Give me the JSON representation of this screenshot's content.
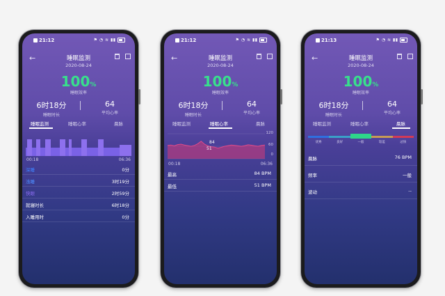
{
  "common": {
    "title": "睡眠监测",
    "date": "2020-08-24",
    "efficiency": "100",
    "efficiency_unit": "%",
    "efficiency_label": "睡眠效率",
    "duration": "6时18分",
    "duration_label": "睡眠时长",
    "avg_hr": "64",
    "avg_hr_label": "平均心率",
    "tabs": [
      "睡眠监测",
      "睡眠心率",
      "晨脉"
    ]
  },
  "phones": [
    {
      "time": "21:12",
      "active_tab": 0,
      "chart": {
        "start": "00:18",
        "end": "06:36"
      },
      "rows": [
        {
          "key": "深睡",
          "value": "0分",
          "color": "#3f82ff"
        },
        {
          "key": "浅睡",
          "value": "3时19分",
          "color": "#4e8dff"
        },
        {
          "key": "快眼",
          "value": "2时59分",
          "color": "#8a6df0"
        },
        {
          "key": "就寝时长",
          "value": "6时18分",
          "color": "#ffffff"
        },
        {
          "key": "入睡用时",
          "value": "0分",
          "color": "#ffffff"
        }
      ]
    },
    {
      "time": "21:12",
      "active_tab": 1,
      "chart": {
        "start": "00:18",
        "end": "06:36",
        "y_ticks": [
          "120",
          "60",
          "0"
        ],
        "max_marker": "84",
        "min_marker": "51"
      },
      "rows": [
        {
          "key": "最高",
          "value": "84 BPM"
        },
        {
          "key": "最低",
          "value": "51 BPM"
        }
      ]
    },
    {
      "time": "21:13",
      "active_tab": 2,
      "scale": {
        "labels": [
          "优秀",
          "良好",
          "一般",
          "较差",
          "过快"
        ],
        "colors": [
          "#2f6fe0",
          "#3aa0c8",
          "#2ed68a",
          "#c79a55",
          "#d23a57"
        ],
        "current_index": 2
      },
      "rows": [
        {
          "key": "晨脉",
          "value": "76 BPM"
        },
        {
          "key": "频率",
          "value": "一般"
        },
        {
          "key": "波动",
          "value": "--"
        }
      ]
    }
  ],
  "chart_data": [
    {
      "type": "bar",
      "title": "",
      "x_range": [
        "00:18",
        "06:36"
      ],
      "note": "sleep stage timeline, alternating light sleep and REM",
      "series": [
        {
          "name": "浅睡",
          "total": "3时19分"
        },
        {
          "name": "快眼",
          "total": "2时59分"
        }
      ]
    },
    {
      "type": "line",
      "title": "",
      "x_range": [
        "00:18",
        "06:36"
      ],
      "ylim": [
        0,
        120
      ],
      "y_ticks": [
        0,
        60,
        120
      ],
      "series": [
        {
          "values": [
            64,
            66,
            62,
            68,
            70,
            66,
            63,
            60,
            64,
            72,
            84,
            70,
            62,
            58,
            56,
            51,
            55,
            60,
            63,
            66,
            64,
            62,
            60,
            63,
            67,
            65,
            62,
            60,
            64,
            66
          ]
        }
      ],
      "max": 84,
      "min": 51
    }
  ]
}
